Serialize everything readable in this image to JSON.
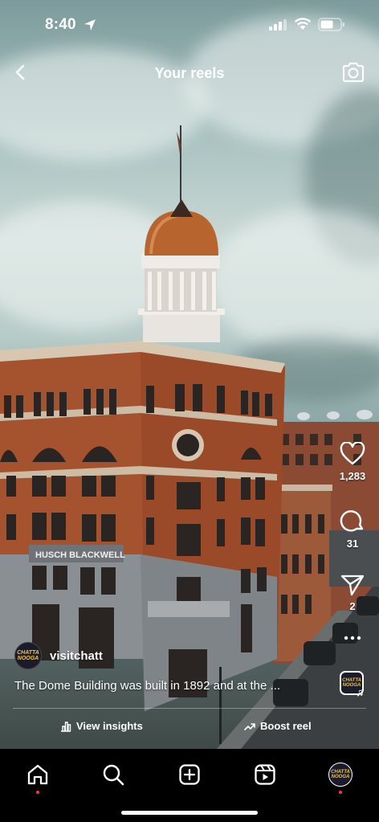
{
  "status_bar": {
    "time": "8:40"
  },
  "header": {
    "title": "Your reels"
  },
  "reel": {
    "building_sign": "HUSCH BLACKWELL",
    "author": {
      "username": "visitchatt",
      "avatar_text": "CHATTA NOOGA"
    },
    "caption": "The Dome Building was built in 1892 and at the ...",
    "actions": {
      "likes": "1,283",
      "comments": "31",
      "shares": "2"
    }
  },
  "footer": {
    "view_insights": "View insights",
    "boost_reel": "Boost reel"
  },
  "tabs": [
    "home",
    "search",
    "create",
    "reels",
    "profile"
  ],
  "colors": {
    "notification_dot": "#ff3040",
    "brick": "#a5522e",
    "dome": "#b8642f"
  }
}
